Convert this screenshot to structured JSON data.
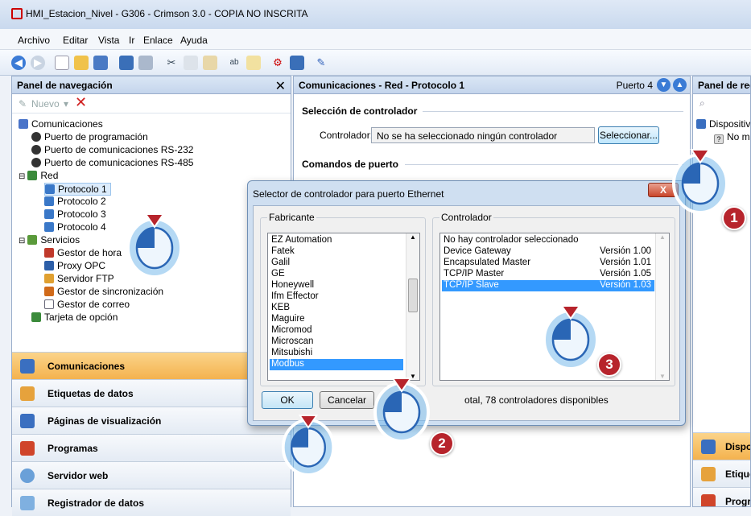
{
  "window": {
    "title": "HMI_Estacion_Nivel - G306 - Crimson 3.0 - COPIA NO INSCRITA"
  },
  "menu": [
    "Archivo",
    "Editar",
    "Vista",
    "Ir",
    "Enlace",
    "Ayuda"
  ],
  "left_panel": {
    "title": "Panel de navegación",
    "new_label": "Nuevo",
    "tree": [
      {
        "label": "Comunicaciones",
        "icon": "communications-icon"
      },
      {
        "label": "Puerto de programación",
        "icon": "port-icon"
      },
      {
        "label": "Puerto de comunicaciones RS-232",
        "icon": "port-icon"
      },
      {
        "label": "Puerto de comunicaciones RS-485",
        "icon": "port-icon"
      },
      {
        "label": "Red",
        "icon": "network-icon"
      },
      {
        "label": "Protocolo 1",
        "icon": "protocol-icon"
      },
      {
        "label": "Protocolo 2",
        "icon": "protocol-icon"
      },
      {
        "label": "Protocolo 3",
        "icon": "protocol-icon"
      },
      {
        "label": "Protocolo 4",
        "icon": "protocol-icon"
      },
      {
        "label": "Servicios",
        "icon": "services-icon"
      },
      {
        "label": "Gestor de hora",
        "icon": "clock-icon"
      },
      {
        "label": "Proxy OPC",
        "icon": "opc-icon"
      },
      {
        "label": "Servidor FTP",
        "icon": "ftp-icon"
      },
      {
        "label": "Gestor de sincronización",
        "icon": "sync-icon"
      },
      {
        "label": "Gestor de correo",
        "icon": "mail-icon"
      },
      {
        "label": "Tarjeta de opción",
        "icon": "card-icon"
      }
    ],
    "categories": [
      {
        "label": "Comunicaciones",
        "active": true
      },
      {
        "label": "Etiquetas de datos",
        "active": false
      },
      {
        "label": "Páginas de visualización",
        "active": false
      },
      {
        "label": "Programas",
        "active": false
      },
      {
        "label": "Servidor web",
        "active": false
      },
      {
        "label": "Registrador de datos",
        "active": false
      }
    ]
  },
  "mid_panel": {
    "title": "Comunicaciones - Red - Protocolo 1",
    "port_label": "Puerto 4",
    "section_controller": "Selección de controlador",
    "controller_label": "Controlador:",
    "controller_value": "No se ha seleccionado ningún controlador",
    "select_button": "Seleccionar...",
    "section_port_commands": "Comandos de puerto"
  },
  "right_panel": {
    "title": "Panel de rec",
    "item1": "Dispositiv",
    "item2": "No ma",
    "cat1": "Dispo",
    "cat2": "Etique",
    "cat3": "Progr"
  },
  "dialog": {
    "title": "Selector de controlador para puerto Ethernet",
    "close_label": "X",
    "manufacturer_group": "Fabricante",
    "manufacturers": [
      "EZ Automation",
      "Fatek",
      "Galil",
      "GE",
      "Honeywell",
      "Ifm Effector",
      "KEB",
      "Maguire",
      "Micromod",
      "Microscan",
      "Mitsubishi",
      "Modbus"
    ],
    "selected_manufacturer": "Modbus",
    "controller_group": "Controlador",
    "controllers": [
      {
        "name": "No hay controlador seleccionado",
        "version": ""
      },
      {
        "name": "Device Gateway",
        "version": "Versión 1.00"
      },
      {
        "name": "Encapsulated Master",
        "version": "Versión 1.01"
      },
      {
        "name": "TCP/IP Master",
        "version": "Versión 1.05"
      },
      {
        "name": "TCP/IP Slave",
        "version": "Versión 1.03"
      }
    ],
    "selected_controller": "TCP/IP Slave",
    "ok_label": "OK",
    "cancel_label": "Cancelar",
    "status_text": "otal, 78 controladores disponibles"
  },
  "callouts": [
    "1",
    "2",
    "3"
  ],
  "colors": {
    "accent": "#b7242c",
    "selection": "#3399ff",
    "active_category": "#f4b24e"
  }
}
